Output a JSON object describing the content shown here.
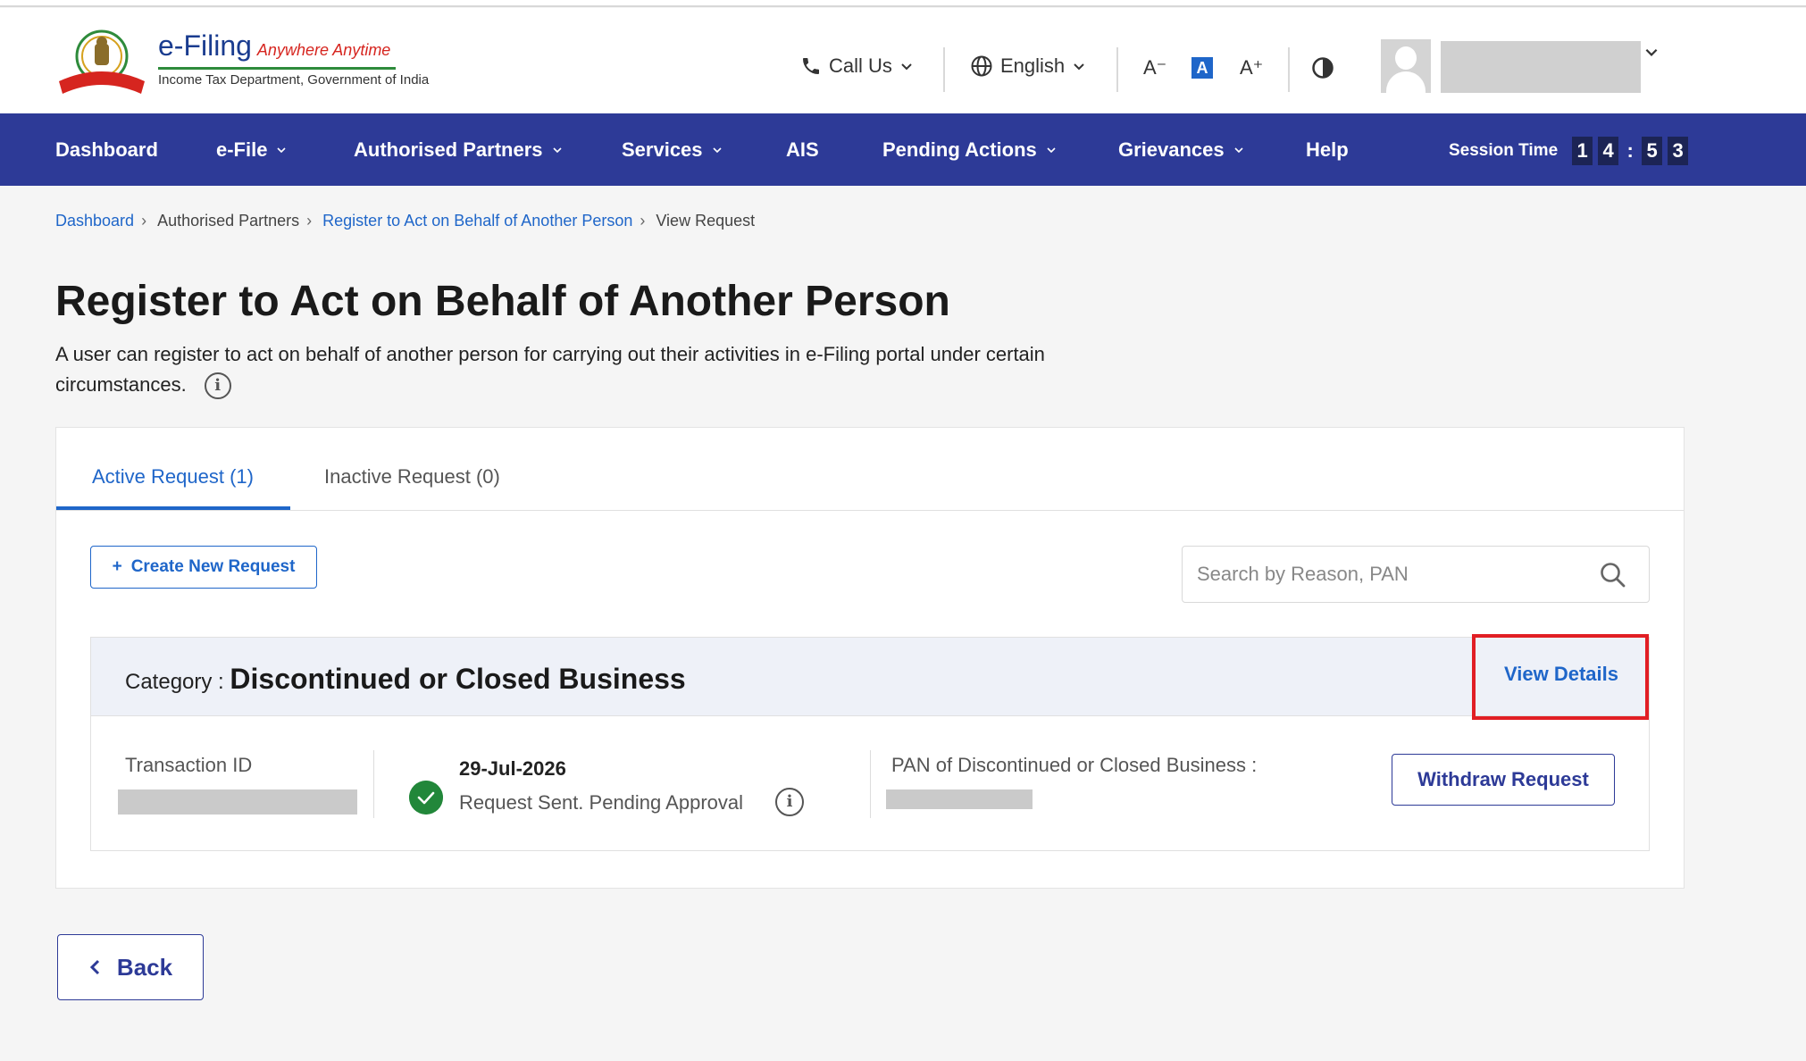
{
  "header": {
    "logo_title": "e-Filing",
    "logo_tagline": "Anywhere Anytime",
    "logo_subtitle": "Income Tax Department, Government of India",
    "call_us": "Call Us",
    "language": "English",
    "font_decrease": "A⁻",
    "font_normal": "A",
    "font_increase": "A⁺"
  },
  "nav": {
    "items": [
      {
        "label": "Dashboard",
        "has_dropdown": false
      },
      {
        "label": "e-File",
        "has_dropdown": true
      },
      {
        "label": "Authorised Partners",
        "has_dropdown": true
      },
      {
        "label": "Services",
        "has_dropdown": true
      },
      {
        "label": "AIS",
        "has_dropdown": false
      },
      {
        "label": "Pending Actions",
        "has_dropdown": true
      },
      {
        "label": "Grievances",
        "has_dropdown": true
      },
      {
        "label": "Help",
        "has_dropdown": false
      }
    ],
    "session_label": "Session Time",
    "session_digits": [
      "1",
      "4",
      "5",
      "3"
    ]
  },
  "breadcrumb": {
    "items": [
      {
        "label": "Dashboard",
        "link": true
      },
      {
        "label": "Authorised Partners",
        "link": false
      },
      {
        "label": "Register to Act on Behalf of Another Person",
        "link": true
      },
      {
        "label": "View Request",
        "link": false
      }
    ]
  },
  "page": {
    "title": "Register to Act on Behalf of Another Person",
    "description": "A user can register to act on behalf of another person for carrying out their activities in e-Filing portal under certain circumstances."
  },
  "tabs": [
    {
      "label": "Active Request (1)",
      "active": true
    },
    {
      "label": "Inactive Request (0)",
      "active": false
    }
  ],
  "toolbar": {
    "create_label": "Create New Request",
    "search_placeholder": "Search by Reason, PAN"
  },
  "request": {
    "category_label": "Category :",
    "category_value": "Discontinued or Closed Business",
    "view_details": "View Details",
    "transaction_label": "Transaction ID",
    "date": "29-Jul-2026",
    "status": "Request Sent. Pending Approval",
    "pan_label": "PAN of Discontinued or Closed Business :",
    "withdraw_label": "Withdraw Request"
  },
  "footer": {
    "back_label": "Back"
  },
  "colors": {
    "nav_bg": "#2d3a97",
    "link_blue": "#1f66c9",
    "highlight_red": "#e11e24",
    "success_green": "#22873a"
  }
}
